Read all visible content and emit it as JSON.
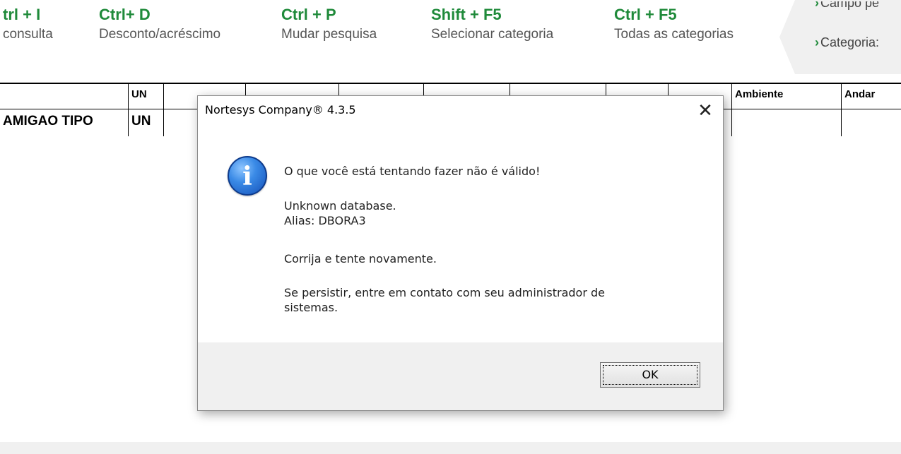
{
  "shortcuts": [
    {
      "key": "trl + I",
      "desc": "consulta"
    },
    {
      "key": "Ctrl+ D",
      "desc": "Desconto/acréscimo"
    },
    {
      "key": "Ctrl + P",
      "desc": "Mudar pesquisa"
    },
    {
      "key": "Shift + F5",
      "desc": "Selecionar categoria"
    },
    {
      "key": "Ctrl + F5",
      "desc": "Todas as categorias"
    }
  ],
  "side_panel": {
    "item1": "Campo pe",
    "item2": "Categoria:"
  },
  "grid": {
    "headers": {
      "un": "UN",
      "ambiente": "Ambiente",
      "andar": "Andar"
    },
    "row": {
      "descricao": "AMIGAO TIPO",
      "un": "UN"
    }
  },
  "dialog": {
    "title": "Nortesys Company® 4.3.5",
    "close": "✕",
    "icon": "info-icon",
    "line1": "O que você está tentando fazer não é válido!",
    "line2": "Unknown database.",
    "line3": "Alias: DBORA3",
    "line4": "Corrija e tente novamente.",
    "line5": "Se persistir, entre em contato com seu administrador de",
    "line6": "sistemas.",
    "ok": "OK"
  },
  "colors": {
    "accent": "#1f8a3a"
  }
}
